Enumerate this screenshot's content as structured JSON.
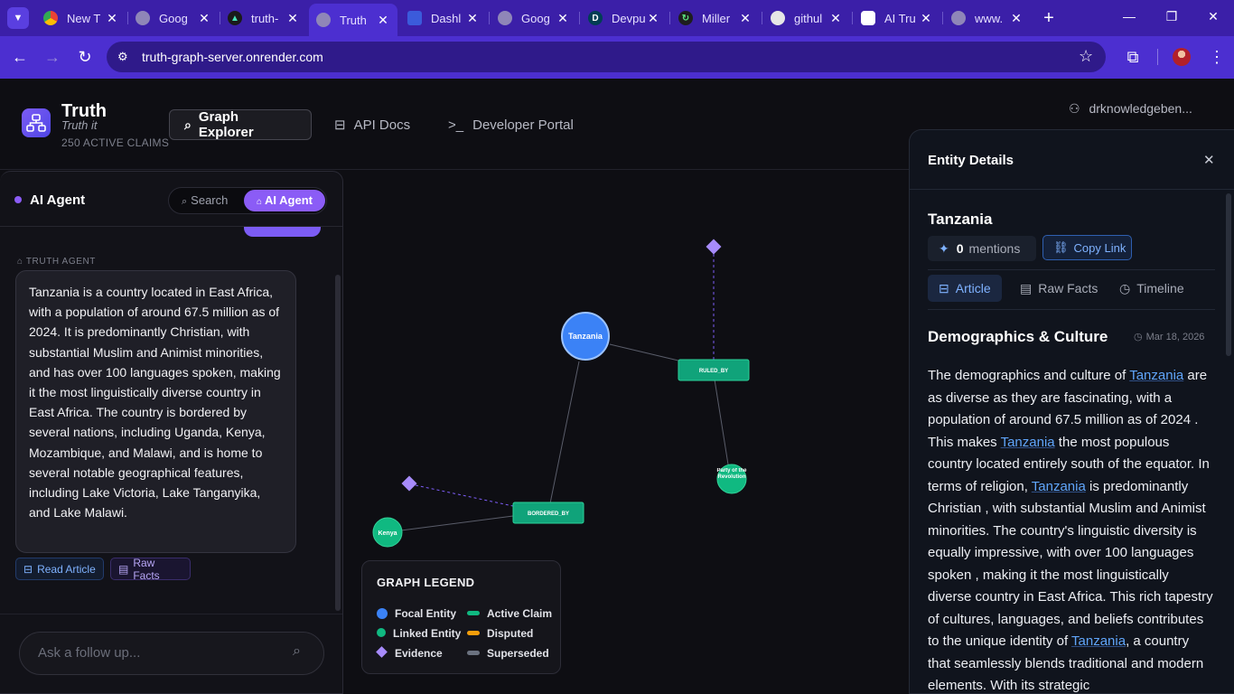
{
  "browser": {
    "tabs": [
      {
        "title": "New T",
        "icon": "chrome-icon"
      },
      {
        "title": "Goog",
        "icon": "globe-icon"
      },
      {
        "title": "truth-",
        "icon": "render-icon"
      },
      {
        "title": "Truth",
        "icon": "globe-icon"
      },
      {
        "title": "Dashl",
        "icon": "dashboard-icon"
      },
      {
        "title": "Goog",
        "icon": "globe-icon"
      },
      {
        "title": "Devpu",
        "icon": "devpost-icon"
      },
      {
        "title": "Miller",
        "icon": "miller-icon"
      },
      {
        "title": "githul",
        "icon": "github-icon"
      },
      {
        "title": "AI Tru",
        "icon": "openai-icon"
      },
      {
        "title": "www.",
        "icon": "globe-icon"
      }
    ],
    "url": "truth-graph-server.onrender.com",
    "accent": "#4c2fd0"
  },
  "header": {
    "app_name": "Truth",
    "tagline": "Truth it",
    "claims": "250 ACTIVE CLAIMS",
    "nav": {
      "graph_explorer": "Graph Explorer",
      "api_docs": "API Docs",
      "developer_portal": "Developer Portal"
    },
    "user": "drknowledgeben..."
  },
  "agent_panel": {
    "title": "AI Agent",
    "mode_search": "Search",
    "mode_agent": "AI Agent",
    "speaker": "TRUTH AGENT",
    "message": "Tanzania is a country located in East Africa, with a population of around 67.5 million as of 2024. It is predominantly Christian, with substantial Muslim and Animist minorities, and has over 100 languages spoken, making it the most linguistically diverse country in East Africa. The country is bordered by several nations, including Uganda, Kenya, Mozambique, and Malawi, and is home to several notable geographical features, including Lake Victoria, Lake Tanganyika, and Lake Malawi.",
    "read_article": "Read Article",
    "raw_facts": "Raw Facts",
    "followup_placeholder": "Ask a follow up..."
  },
  "graph": {
    "nodes": {
      "tanzania": "Tanzania",
      "ruled_by": "RULED_BY",
      "party": "Party of the Revolution",
      "bordered_by": "BORDERED_BY",
      "kenya": "Kenya"
    },
    "legend": {
      "title": "GRAPH LEGEND",
      "focal": "Focal Entity",
      "linked": "Linked Entity",
      "evidence": "Evidence",
      "active": "Active Claim",
      "disputed": "Disputed",
      "superseded": "Superseded"
    },
    "colors": {
      "focal": "#3b82f6",
      "linked": "#10b981",
      "evidence": "#a78bfa",
      "disputed": "#f59e0b",
      "superseded": "#6b7280"
    }
  },
  "entity_panel": {
    "title": "Entity Details",
    "entity": "Tanzania",
    "mentions_count": "0",
    "mentions_label": "mentions",
    "copy_link": "Copy Link",
    "tabs": {
      "article": "Article",
      "raw_facts": "Raw Facts",
      "timeline": "Timeline"
    },
    "section_title": "Demographics & Culture",
    "date": "Mar 18, 2026",
    "article": {
      "p1": "The demographics and culture of ",
      "link": "Tanzania",
      "p2": " are as diverse as they are fascinating, with a population of around 67.5 million as of 2024 . This makes ",
      "p3": " the most populous country located entirely south of the equator. In terms of religion, ",
      "p4": " is predominantly Christian , with substantial Muslim and Animist minorities. The country's linguistic diversity is equally impressive, with over 100 languages spoken , making it the most linguistically diverse country in East Africa. This rich tapestry of cultures, languages, and beliefs contributes to the unique identity of ",
      "p5": ", a country that seamlessly blends traditional and modern elements. With its strategic"
    }
  }
}
